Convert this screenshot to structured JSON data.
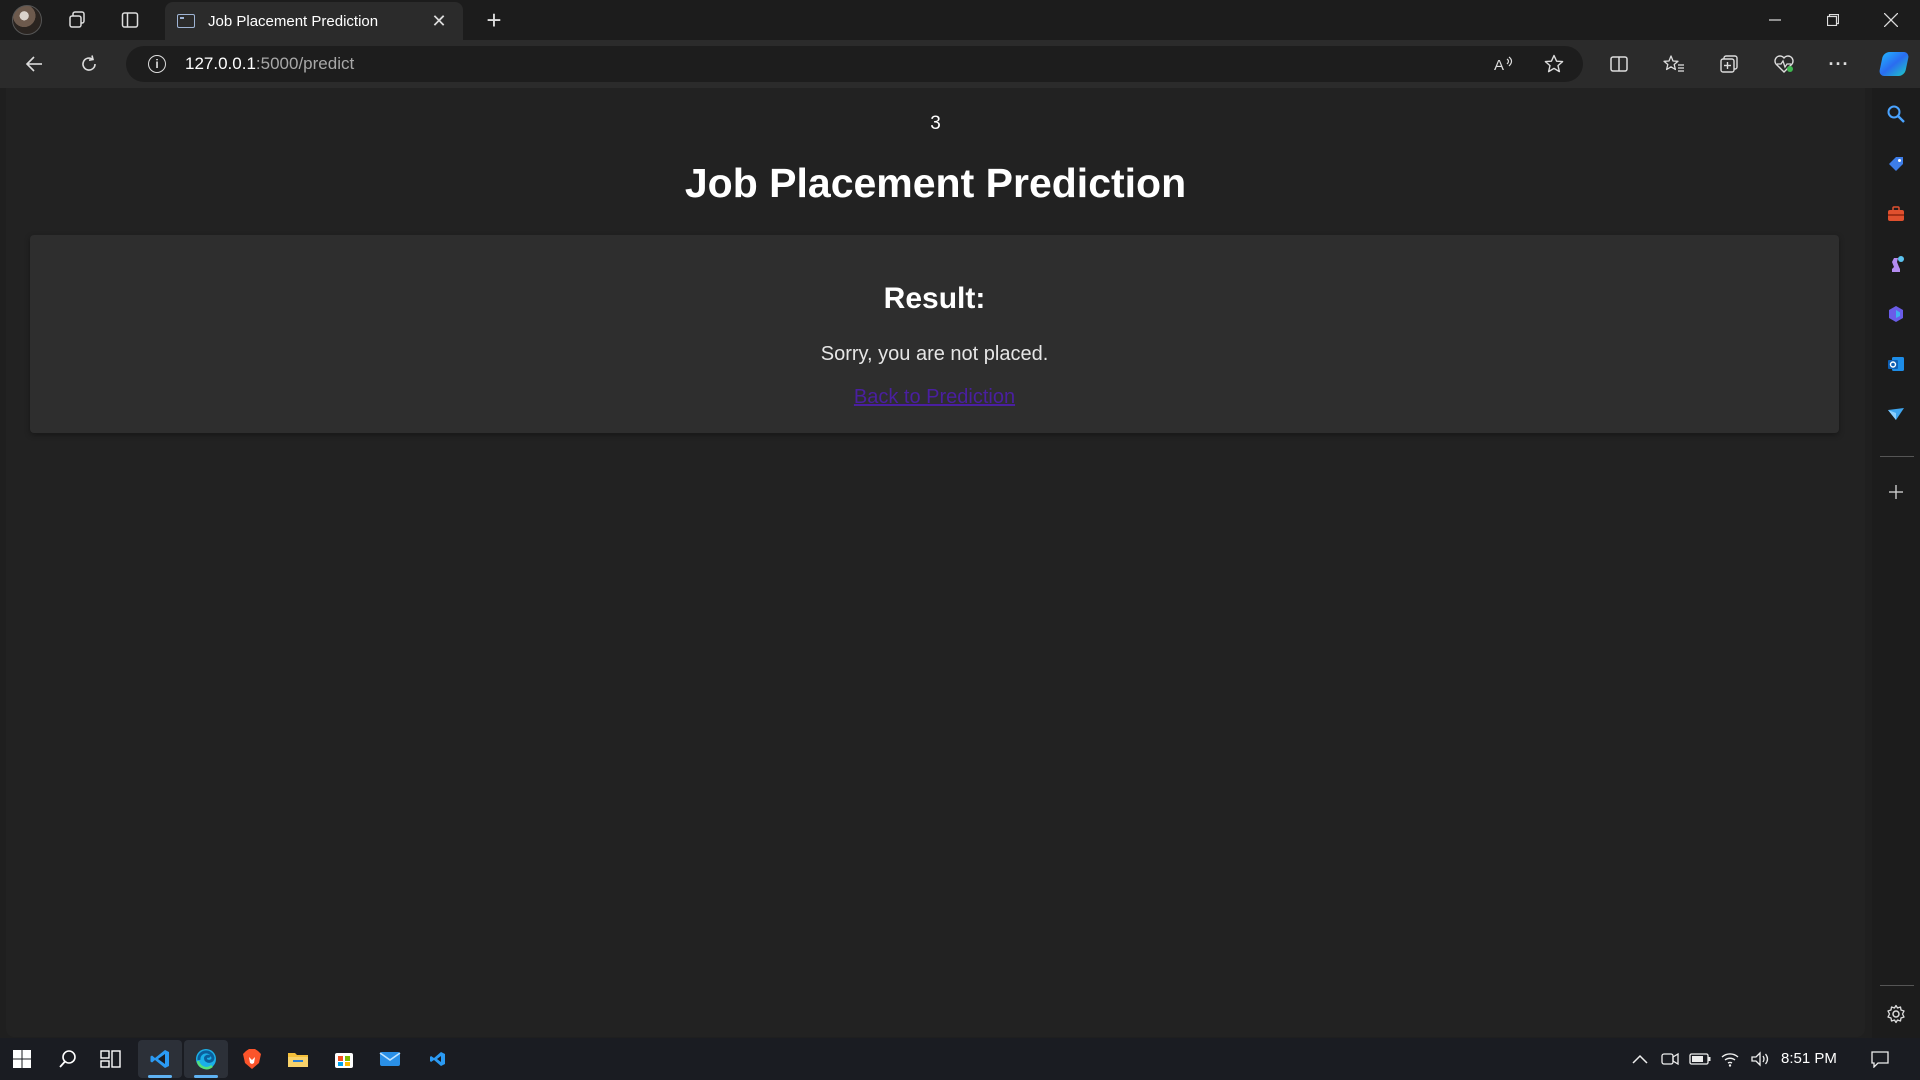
{
  "browser": {
    "tab_title": "Job Placement Prediction",
    "url_host": "127.0.0.1",
    "url_path": ":5000/predict"
  },
  "page": {
    "counter": "3",
    "title": "Job Placement Prediction",
    "result_heading": "Result:",
    "result_text": "Sorry, you are not placed.",
    "back_link_label": "Back to Prediction"
  },
  "taskbar": {
    "time": "8:51 PM"
  },
  "colors": {
    "page_bg": "#222222",
    "card_bg": "#2e2e2e",
    "link": "#4a1fa0",
    "chrome_bg": "#1c1c1c"
  }
}
